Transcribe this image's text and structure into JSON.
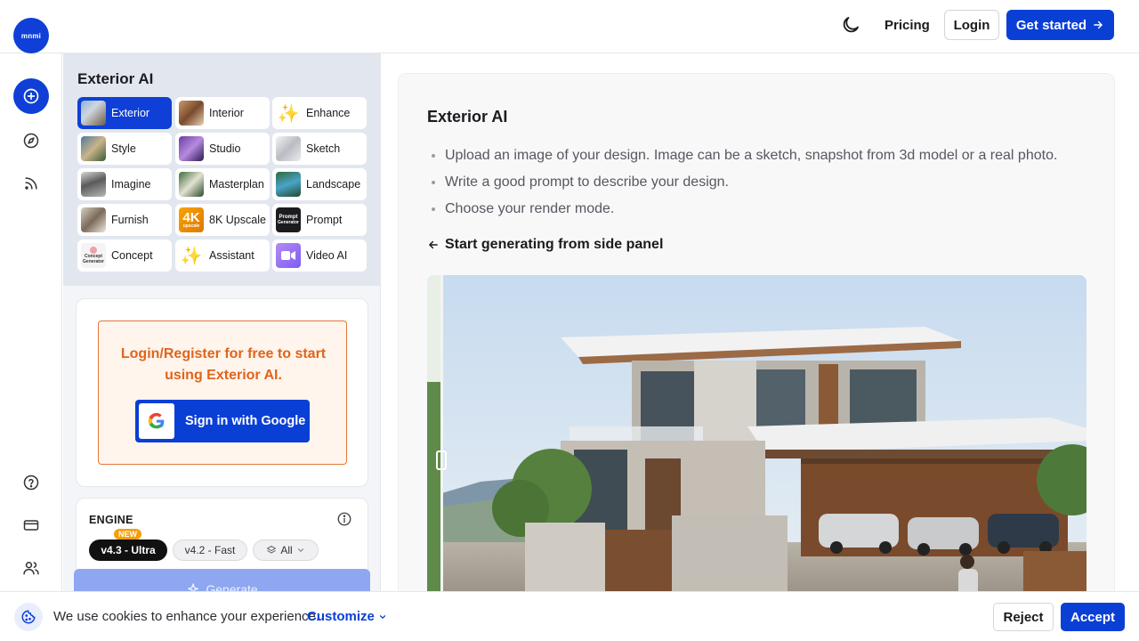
{
  "header": {
    "logo_text": "mnmi",
    "theme_icon": "moon-icon",
    "pricing_label": "Pricing",
    "login_label": "Login",
    "get_started_label": "Get started"
  },
  "rail": {
    "items": [
      {
        "icon": "plus-circle-icon"
      },
      {
        "icon": "compass-icon"
      },
      {
        "icon": "rss-icon"
      },
      {
        "icon": "help-icon"
      },
      {
        "icon": "credit-card-icon"
      },
      {
        "icon": "users-icon"
      }
    ]
  },
  "panel": {
    "title": "Exterior AI",
    "tools": [
      {
        "label": "Exterior",
        "active": true
      },
      {
        "label": "Interior"
      },
      {
        "label": "Enhance"
      },
      {
        "label": "Style"
      },
      {
        "label": "Studio"
      },
      {
        "label": "Sketch"
      },
      {
        "label": "Imagine"
      },
      {
        "label": "Masterplan"
      },
      {
        "label": "Landscape"
      },
      {
        "label": "Furnish"
      },
      {
        "label": "8K Upscale"
      },
      {
        "label": "Prompt"
      },
      {
        "label": "Concept"
      },
      {
        "label": "Assistant"
      },
      {
        "label": "Video AI"
      }
    ],
    "thumb_texts": {
      "upscale_top": "4K",
      "upscale_bottom": "upscale",
      "prompt_line1": "Prompt",
      "prompt_line2": "Generator",
      "concept_line1": "Concept",
      "concept_line2": "Generator"
    },
    "login_prompt": "Login/Register for free to start using Exterior AI.",
    "google_button": "Sign in with Google",
    "engine": {
      "label": "ENGINE",
      "badge": "NEW",
      "options": [
        "v4.3 - Ultra",
        "v4.2 - Fast",
        "All"
      ],
      "selected": "v4.3 - Ultra"
    },
    "generate_label": "Generate"
  },
  "main": {
    "title": "Exterior AI",
    "bullets": [
      "Upload an image of your design. Image can be a sketch, snapshot from 3d model or a real photo.",
      "Write a good prompt to describe your design.",
      "Choose your render mode."
    ],
    "start_link": "Start generating from side panel"
  },
  "cookie": {
    "text": "We use cookies to enhance your experience.",
    "customize": "Customize",
    "reject": "Reject",
    "accept": "Accept"
  },
  "colors": {
    "primary": "#0a3fd6",
    "orange": "#e0641c",
    "panel_bg": "#e2e7ef"
  }
}
